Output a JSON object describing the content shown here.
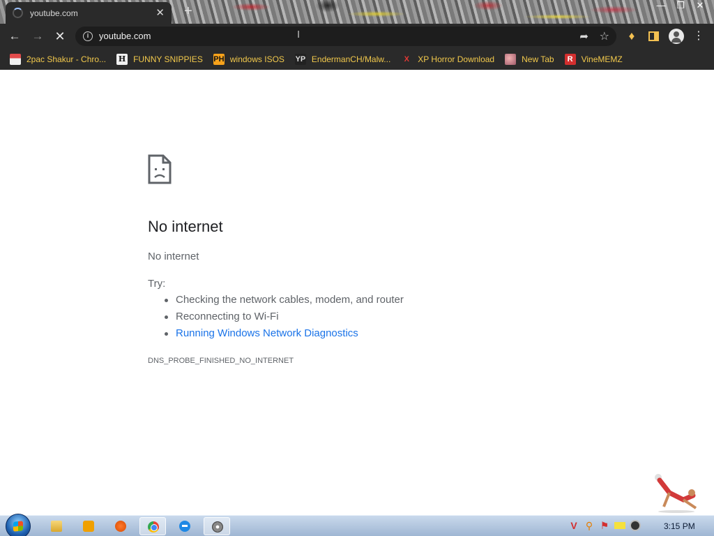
{
  "browser": {
    "tab": {
      "title": "youtube.com",
      "close": "✕"
    },
    "new_tab": "+",
    "window_controls": {
      "minimize": "—",
      "restore": "❐",
      "close": "✕"
    },
    "url": "youtube.com",
    "bookmarks": [
      {
        "label": "2pac Shakur - Chro...",
        "icon": "2pac-favicon"
      },
      {
        "label": "FUNNY SNIPPIES",
        "icon": "h-favicon"
      },
      {
        "label": "windows ISOS",
        "icon": "ph-favicon"
      },
      {
        "label": "EndermanCH/Malw...",
        "icon": "yp-favicon"
      },
      {
        "label": "XP Horror Download",
        "icon": "x-favicon"
      },
      {
        "label": "New Tab",
        "icon": "new-tab-favicon"
      },
      {
        "label": "VineMEMZ",
        "icon": "r-favicon"
      }
    ]
  },
  "error": {
    "title": "No internet",
    "subtitle": "No internet",
    "try_label": "Try:",
    "suggestions": [
      "Checking the network cables, modem, and router",
      "Reconnecting to Wi-Fi",
      "Running Windows Network Diagnostics"
    ],
    "code": "DNS_PROBE_FINISHED_NO_INTERNET"
  },
  "taskbar": {
    "apps": [
      "explorer",
      "media-player",
      "paint",
      "chrome",
      "internet-explorer",
      "disc-app"
    ],
    "active_app": "chrome",
    "clock": "3:15 PM"
  }
}
